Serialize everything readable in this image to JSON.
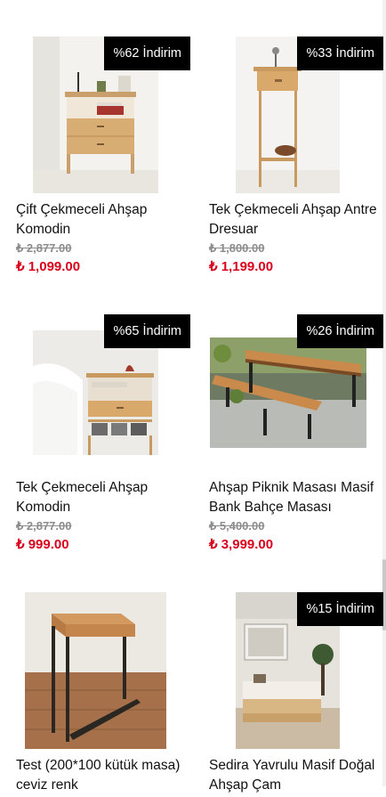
{
  "products": [
    {
      "name": "Çift Çekmeceli Ahşap Komodin",
      "old_price": "₺ 2,877.00",
      "price": "₺ 1,099.00",
      "badge": "%62 İndirim"
    },
    {
      "name": "Tek Çekmeceli Ahşap Antre Dresuar",
      "old_price": "₺ 1,800.00",
      "price": "₺ 1,199.00",
      "badge": "%33 İndirim"
    },
    {
      "name": "Tek Çekmeceli Ahşap Komodin",
      "old_price": "₺ 2,877.00",
      "price": "₺ 999.00",
      "badge": "%65 İndirim"
    },
    {
      "name": "Ahşap Piknik Masası Masif Bank Bahçe Masası",
      "old_price": "₺ 5,400.00",
      "price": "₺ 3,999.00",
      "badge": "%26 İndirim"
    },
    {
      "name": "Test (200*100 kütük masa) ceviz renk",
      "old_price": "",
      "price": "",
      "badge": ""
    },
    {
      "name": "Sedira Yavrulu Masif Doğal Ahşap Çam",
      "old_price": "",
      "price": "",
      "badge": "%15 İndirim"
    }
  ]
}
